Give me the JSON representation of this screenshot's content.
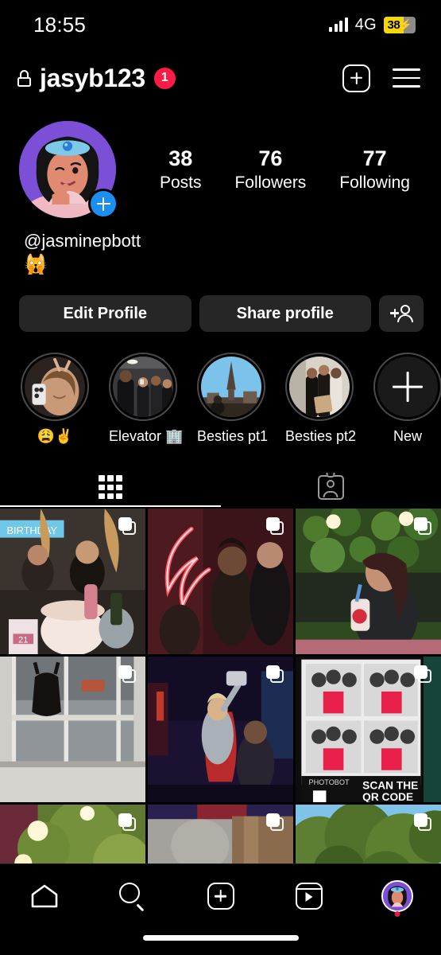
{
  "status_bar": {
    "time": "18:55",
    "network": "4G",
    "battery_pct": "38",
    "charging_glyph": "⚡",
    "signal_icon": "signal-bars-icon",
    "battery_color": "#f5d800"
  },
  "header": {
    "username": "jasyb123",
    "lock_icon": "lock-icon",
    "notification_count": "1",
    "create_icon": "plus-square-icon",
    "menu_icon": "hamburger-menu-icon",
    "badge_color": "#ff1b46"
  },
  "profile": {
    "avatar_name": "profile-avatar",
    "avatar_add_story_icon": "plus-icon",
    "handle": "@jasminepbott",
    "bio_emoji": "🙀",
    "stats": [
      {
        "num": "38",
        "label": "Posts"
      },
      {
        "num": "76",
        "label": "Followers"
      },
      {
        "num": "77",
        "label": "Following"
      }
    ]
  },
  "actions": {
    "edit_profile": "Edit Profile",
    "share_profile": "Share profile",
    "add_person_icon": "add-person-icon"
  },
  "highlights": [
    {
      "label": "😩✌️",
      "name": "highlight-emoji"
    },
    {
      "label": "Elevator 🏢",
      "name": "highlight-elevator"
    },
    {
      "label": "Besties pt1",
      "name": "highlight-besties-pt1"
    },
    {
      "label": "Besties pt2",
      "name": "highlight-besties-pt2"
    },
    {
      "label": "New",
      "name": "highlight-new"
    }
  ],
  "tabs": [
    {
      "name": "tab-grid",
      "icon": "grid-icon",
      "active": true
    },
    {
      "name": "tab-tagged",
      "icon": "tagged-person-icon",
      "active": false
    }
  ],
  "posts": [
    {
      "name": "post-birthday-party",
      "carousel": true
    },
    {
      "name": "post-neon-wings",
      "carousel": true
    },
    {
      "name": "post-green-wall-drink",
      "carousel": true
    },
    {
      "name": "post-balcony-window",
      "carousel": true
    },
    {
      "name": "post-thor-performer",
      "carousel": true
    },
    {
      "name": "post-photobooth-strip",
      "carousel": true
    },
    {
      "name": "post-garden-lights",
      "carousel": true
    },
    {
      "name": "post-indoor-blur",
      "carousel": true
    },
    {
      "name": "post-trees-sky",
      "carousel": true
    }
  ],
  "bottom_nav": [
    {
      "name": "nav-home",
      "icon": "home-icon"
    },
    {
      "name": "nav-search",
      "icon": "search-icon"
    },
    {
      "name": "nav-create",
      "icon": "plus-square-icon"
    },
    {
      "name": "nav-reels",
      "icon": "reels-icon"
    },
    {
      "name": "nav-profile",
      "icon": "avatar-icon",
      "has_dot": true
    }
  ]
}
